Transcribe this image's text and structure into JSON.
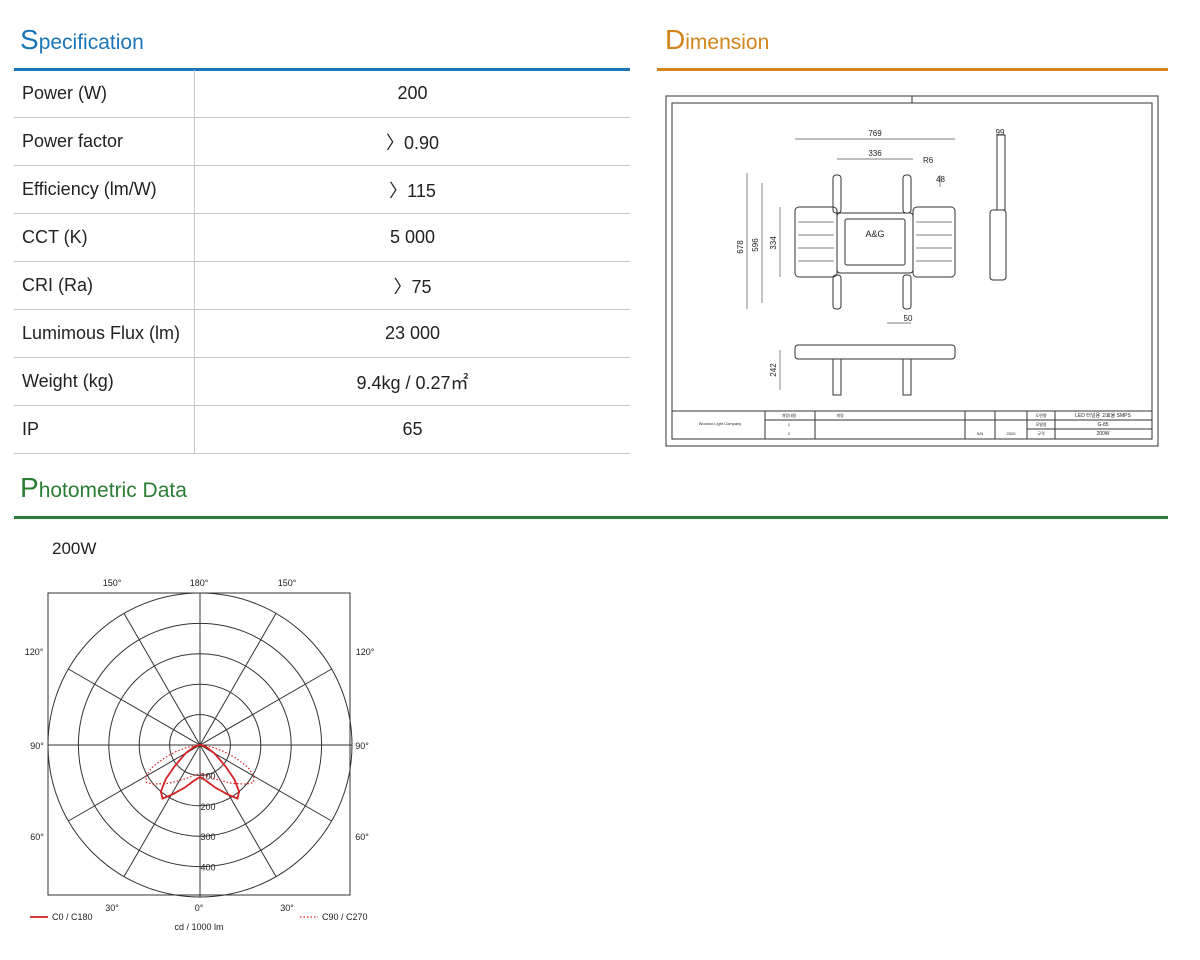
{
  "specification": {
    "title_first": "S",
    "title_rest": "pecification",
    "color": "#1a76b8",
    "rows": [
      {
        "label": "Power (W)",
        "value": "200"
      },
      {
        "label": "Power factor",
        "value": "〉0.90"
      },
      {
        "label": "Efficiency (lm/W)",
        "value": "〉115"
      },
      {
        "label": "CCT (K)",
        "value": "5 000"
      },
      {
        "label": "CRI (Ra)",
        "value": "〉75"
      },
      {
        "label": "Lumimous Flux (lm)",
        "value": "23 000"
      },
      {
        "label": "Weight (kg)",
        "value": "9.4kg / 0.27㎡"
      },
      {
        "label": "IP",
        "value": "65"
      }
    ]
  },
  "dimension": {
    "title_first": "D",
    "title_rest": "imension",
    "color": "#d4841a",
    "drawing": {
      "dims": [
        "769",
        "336",
        "R6",
        "48",
        "99",
        "678",
        "596",
        "334",
        "50",
        "242"
      ],
      "brand": "A&G",
      "title_block": {
        "left_label": "Woosoo Light Company",
        "cells": [
          "개정내용",
          "개정",
          "1",
          "2",
          "도면명",
          "모델명",
          "규격",
          "S/N",
          "2020"
        ],
        "product": "LED 터널용 고효율 SMPS",
        "model": "G-85",
        "spec": "200W"
      }
    }
  },
  "photometric": {
    "title_first": "P",
    "title_rest": "hotometric Data",
    "color": "#2a7d35",
    "subtitle": "200W"
  },
  "chart_data": {
    "type": "polar",
    "title": "200W",
    "angle_labels": [
      "150°",
      "180°",
      "150°",
      "120°",
      "120°",
      "90°",
      "90°",
      "60°",
      "60°",
      "30°",
      "0°",
      "30°"
    ],
    "radial_ticks": [
      100,
      200,
      300,
      400
    ],
    "rmax": 500,
    "unit": "cd / 1000 lm",
    "series": [
      {
        "name": "C0 / C180",
        "color": "#d42020",
        "style": "solid",
        "points": [
          [
            0,
            105
          ],
          [
            10,
            120
          ],
          [
            20,
            150
          ],
          [
            30,
            190
          ],
          [
            35,
            215
          ],
          [
            40,
            200
          ],
          [
            45,
            160
          ],
          [
            50,
            110
          ],
          [
            60,
            55
          ],
          [
            70,
            25
          ],
          [
            80,
            8
          ],
          [
            90,
            0
          ]
        ]
      },
      {
        "name": "C90 / C270",
        "color": "#d42020",
        "style": "dotted",
        "points": [
          [
            0,
            95
          ],
          [
            10,
            100
          ],
          [
            20,
            115
          ],
          [
            30,
            135
          ],
          [
            40,
            165
          ],
          [
            50,
            200
          ],
          [
            55,
            215
          ],
          [
            60,
            205
          ],
          [
            65,
            175
          ],
          [
            70,
            125
          ],
          [
            75,
            80
          ],
          [
            80,
            40
          ],
          [
            90,
            0
          ]
        ]
      }
    ]
  }
}
